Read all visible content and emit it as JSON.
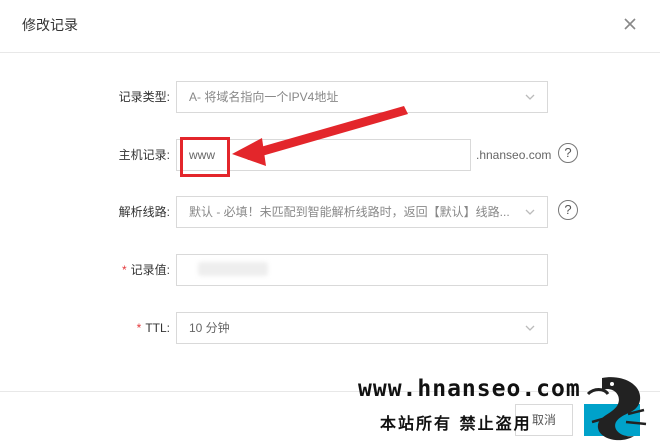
{
  "dialog": {
    "title": "修改记录"
  },
  "form": {
    "record_type": {
      "label": "记录类型:",
      "value": "A- 将域名指向一个IPV4地址"
    },
    "host": {
      "label": "主机记录:",
      "value": "www",
      "suffix": ".hnanseo.com",
      "help": "?"
    },
    "line": {
      "label": "解析线路:",
      "value": "默认 - 必填！未匹配到智能解析线路时，返回【默认】线路...",
      "help": "?"
    },
    "record_value": {
      "required_mark": "*",
      "label": "记录值:",
      "value": ""
    },
    "ttl": {
      "required_mark": "*",
      "label": "TTL:",
      "value": "10 分钟"
    }
  },
  "footer": {
    "cancel_label": "取消"
  },
  "watermark": {
    "line1": "www.hnanseo.com",
    "line2": "本站所有  禁止盗用"
  },
  "colors": {
    "accent": "#00a2ca",
    "annotation": "#e3262b",
    "required": "#e4393c"
  }
}
